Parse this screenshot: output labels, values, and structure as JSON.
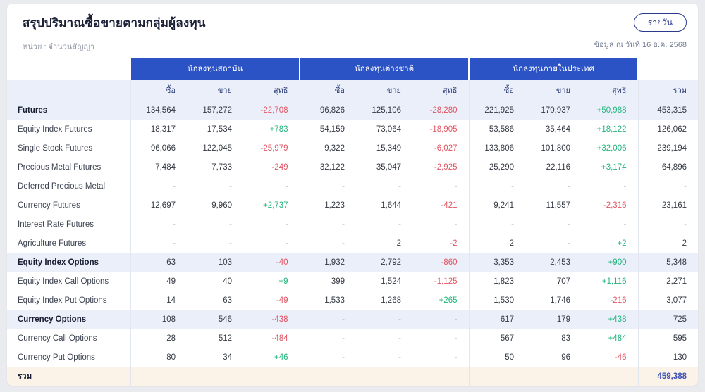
{
  "page": {
    "title": "สรุปปริมาณซื้อขายตามกลุ่มผู้ลงทุน",
    "unit_label": "หน่วย : จำนวนสัญญา",
    "as_of": "ข้อมูล ณ วันที่ 16 ธ.ค. 2568",
    "view_button_label": "รายวัน"
  },
  "colors": {
    "header_blue": "#2b53c6",
    "subheader_bg": "#ebeffa",
    "section_row_bg": "#eaeffa",
    "total_row_bg": "#fbf3e8",
    "positive": "#22b57c",
    "negative": "#e25563",
    "total_value_blue": "#3f51b5"
  },
  "table": {
    "groups": [
      "นักลงทุนสถาบัน",
      "นักลงทุนต่างชาติ",
      "นักลงทุนภายในประเทศ"
    ],
    "sub_headers": [
      "ซื้อ",
      "ขาย",
      "สุทธิ"
    ],
    "total_header": "รวม",
    "rows": [
      {
        "label": "Futures",
        "type": "section",
        "cells": [
          "134,564",
          "157,272",
          "-22,708",
          "96,826",
          "125,106",
          "-28,280",
          "221,925",
          "170,937",
          "+50,988"
        ],
        "total": "453,315"
      },
      {
        "label": "Equity Index Futures",
        "type": "detail",
        "cells": [
          "18,317",
          "17,534",
          "+783",
          "54,159",
          "73,064",
          "-18,905",
          "53,586",
          "35,464",
          "+18,122"
        ],
        "total": "126,062"
      },
      {
        "label": "Single Stock Futures",
        "type": "detail",
        "cells": [
          "96,066",
          "122,045",
          "-25,979",
          "9,322",
          "15,349",
          "-6,027",
          "133,806",
          "101,800",
          "+32,006"
        ],
        "total": "239,194"
      },
      {
        "label": "Precious Metal Futures",
        "type": "detail",
        "cells": [
          "7,484",
          "7,733",
          "-249",
          "32,122",
          "35,047",
          "-2,925",
          "25,290",
          "22,116",
          "+3,174"
        ],
        "total": "64,896"
      },
      {
        "label": "Deferred Precious Metal",
        "type": "detail",
        "cells": [
          "-",
          "-",
          "-",
          "-",
          "-",
          "-",
          "-",
          "-",
          "-"
        ],
        "total": "-"
      },
      {
        "label": "Currency Futures",
        "type": "detail",
        "cells": [
          "12,697",
          "9,960",
          "+2,737",
          "1,223",
          "1,644",
          "-421",
          "9,241",
          "11,557",
          "-2,316"
        ],
        "total": "23,161"
      },
      {
        "label": "Interest Rate Futures",
        "type": "detail",
        "cells": [
          "-",
          "-",
          "-",
          "-",
          "-",
          "-",
          "-",
          "-",
          "-"
        ],
        "total": "-"
      },
      {
        "label": "Agriculture Futures",
        "type": "detail",
        "cells": [
          "-",
          "-",
          "-",
          "-",
          "2",
          "-2",
          "2",
          "-",
          "+2"
        ],
        "total": "2"
      },
      {
        "label": "Equity Index Options",
        "type": "section",
        "cells": [
          "63",
          "103",
          "-40",
          "1,932",
          "2,792",
          "-860",
          "3,353",
          "2,453",
          "+900"
        ],
        "total": "5,348"
      },
      {
        "label": "Equity Index Call Options",
        "type": "detail",
        "cells": [
          "49",
          "40",
          "+9",
          "399",
          "1,524",
          "-1,125",
          "1,823",
          "707",
          "+1,116"
        ],
        "total": "2,271"
      },
      {
        "label": "Equity Index Put Options",
        "type": "detail",
        "cells": [
          "14",
          "63",
          "-49",
          "1,533",
          "1,268",
          "+265",
          "1,530",
          "1,746",
          "-216"
        ],
        "total": "3,077"
      },
      {
        "label": "Currency Options",
        "type": "section",
        "cells": [
          "108",
          "546",
          "-438",
          "-",
          "-",
          "-",
          "617",
          "179",
          "+438"
        ],
        "total": "725"
      },
      {
        "label": "Currency Call Options",
        "type": "detail",
        "cells": [
          "28",
          "512",
          "-484",
          "-",
          "-",
          "-",
          "567",
          "83",
          "+484"
        ],
        "total": "595"
      },
      {
        "label": "Currency Put Options",
        "type": "detail",
        "cells": [
          "80",
          "34",
          "+46",
          "-",
          "-",
          "-",
          "50",
          "96",
          "-46"
        ],
        "total": "130"
      },
      {
        "label": "รวม",
        "type": "total",
        "cells": [
          "",
          "",
          "",
          "",
          "",
          "",
          "",
          "",
          ""
        ],
        "total": "459,388"
      }
    ]
  }
}
